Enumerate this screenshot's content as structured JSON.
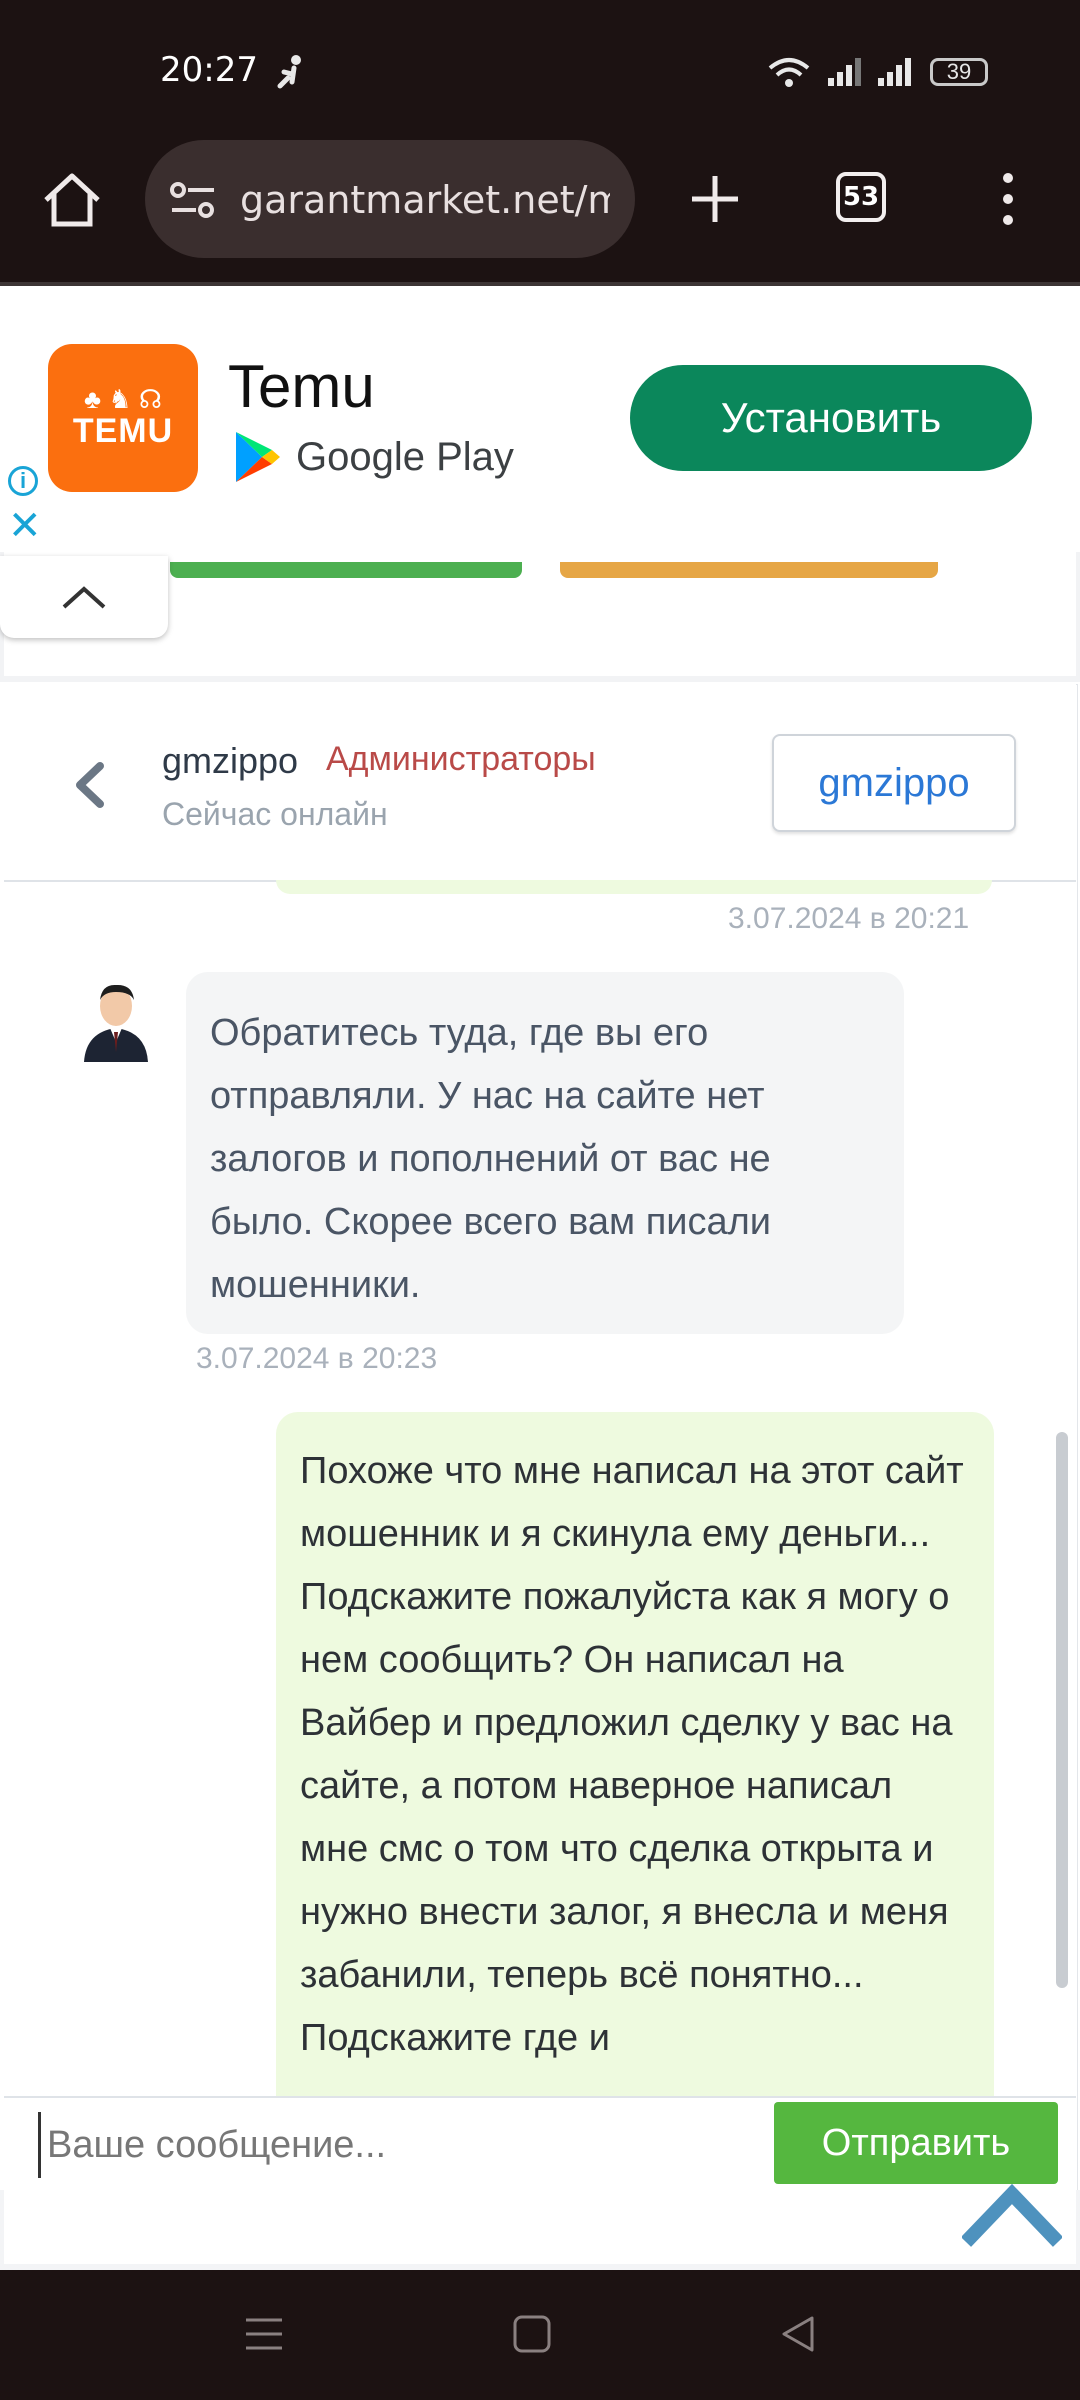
{
  "status_bar": {
    "time": "20:27",
    "battery": "39"
  },
  "browser": {
    "url": "garantmarket.net/me",
    "tab_count": "53"
  },
  "ad": {
    "app_name": "Temu",
    "logo_text": "TEMU",
    "store": "Google Play",
    "install_label": "Установить",
    "close_symbol": "✕",
    "info_symbol": "i"
  },
  "chat": {
    "header": {
      "username": "gmzippo",
      "role": "Администраторы",
      "status": "Сейчас онлайн",
      "profile_button": "gmzippo"
    },
    "messages": [
      {
        "direction": "out",
        "timestamp": "3.07.2024 в 20:21"
      },
      {
        "direction": "in",
        "text": "Обратитесь туда, где вы его отправляли. У нас на сайте нет залогов и пополнений от вас не было. Скорее всего вам писали мошенники.",
        "timestamp": "3.07.2024 в 20:23"
      },
      {
        "direction": "out",
        "text": "Похоже что мне написал на этот сайт мошенник и я скинула ему деньги... Подскажите пожалуйста как я могу о нем сообщить? Он написал на Вайбер и предложил сделку у вас на сайте, а потом наверное написал мне смс о том что сделка открыта и нужно внести залог, я внесла и меня забанили, теперь всё понятно... Подскажите где и"
      }
    ],
    "composer": {
      "placeholder": "Ваше сообщение...",
      "send_label": "Отправить"
    }
  },
  "colors": {
    "accent_green": "#55b73f",
    "admin_red": "#b94a48",
    "link_blue": "#2b78d6",
    "install_green": "#0b875b",
    "temu_orange": "#fb6f0f"
  }
}
